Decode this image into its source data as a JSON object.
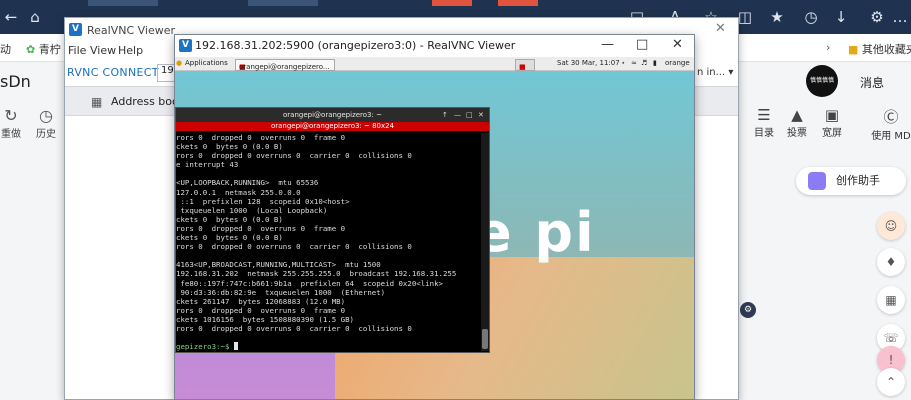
{
  "browser": {
    "bookmarks": [
      "动",
      "青柠",
      "其他收藏夹"
    ],
    "logo_fragment": "sDn",
    "left_tools": [
      {
        "icon": "refresh-icon",
        "label": "重做"
      },
      {
        "icon": "history-icon",
        "label": "历史"
      }
    ],
    "right_tools": [
      {
        "icon": "list-icon",
        "label": "目录"
      },
      {
        "icon": "vote-icon",
        "label": "投票"
      },
      {
        "icon": "screen-icon",
        "label": "宽屏"
      },
      {
        "icon": "help-icon",
        "label": "使用 MD"
      }
    ],
    "avatar_text": "慎慎慎慎",
    "messages_label": "消息",
    "assistant_label": "创作助手"
  },
  "realvnc_viewer": {
    "title": "RealVNC Viewer",
    "menu": [
      "File",
      "View",
      "Help"
    ],
    "brand": "RVNC CONNECT",
    "search_value": "192",
    "user_label": "n in...",
    "address_book_label": "Address book"
  },
  "vnc_session": {
    "title": "192.168.31.202:5900 (orangepizero3:0) - RealVNC Viewer",
    "remote": {
      "applications_label": "Applications",
      "task1": "orangepi@orangepizero...",
      "task2": "orangepi@orangepizero...",
      "clock": "Sat 30 Mar, 11:07",
      "user": "orange",
      "wordmark": "e pi"
    },
    "terminal": {
      "title": "orangepi@orangepizero3: ~",
      "subtitle": "orangepi@orangepizero3: ~ 80x24",
      "lines": [
        "rors 0  dropped 0  overruns 0  frame 0",
        "ckets 0  bytes 0 (0.0 B)",
        "rors 0  dropped 0 overruns 0  carrier 0  collisions 0",
        "e interrupt 43",
        "",
        "<UP,LOOPBACK,RUNNING>  mtu 65536",
        "127.0.0.1  netmask 255.0.0.0",
        " ::1  prefixlen 128  scopeid 0x10<host>",
        " txqueuelen 1000  (Local Loopback)",
        "ckets 0  bytes 0 (0.0 B)",
        "rors 0  dropped 0  overruns 0  frame 0",
        "ckets 0  bytes 0 (0.0 B)",
        "rors 0  dropped 0 overruns 0  carrier 0  collisions 0",
        "",
        "4163<UP,BROADCAST,RUNNING,MULTICAST>  mtu 1500",
        "192.168.31.202  netmask 255.255.255.0  broadcast 192.168.31.255",
        " fe80::197f:747c:b661:9b1a  prefixlen 64  scopeid 0x20<link>",
        " 90:d3:36:db:82:9e  txqueuelen 1000  (Ethernet)",
        "ckets 261147  bytes 12068883 (12.0 MB)",
        "rors 0  dropped 0  overruns 0  frame 0",
        "ckets 1016156  bytes 1508880390 (1.5 GB)",
        "rors 0  dropped 0 overruns 0  carrier 0  collisions 0",
        "",
        "gepizero3:~$ "
      ]
    }
  },
  "colors": {
    "terminal_bar": "#cc0000",
    "vnc_brand": "#1b6fc1",
    "browser_tabbar": "#1f3350"
  }
}
